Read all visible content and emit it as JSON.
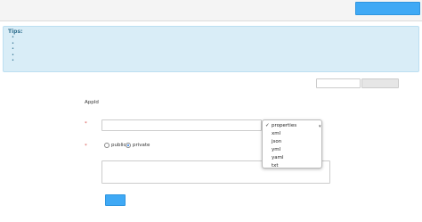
{
  "header": {
    "title": "",
    "hint": "",
    "back_button": ""
  },
  "tips": {
    "title": "Tips:",
    "items": [
      "",
      "",
      "",
      "",
      "",
      "",
      ""
    ]
  },
  "tabs": {
    "link_public": "",
    "create": ""
  },
  "form": {
    "appid_label": "AppId",
    "appid_value": "",
    "name_label": "",
    "type_label": "",
    "type_options": [
      "public",
      "private"
    ],
    "type_selected": "private",
    "remark_label": "",
    "submit": ""
  },
  "format_dropdown": {
    "selected": "properties",
    "options": [
      "properties",
      "xml",
      "json",
      "yml",
      "yaml",
      "txt"
    ]
  },
  "watermark": ""
}
